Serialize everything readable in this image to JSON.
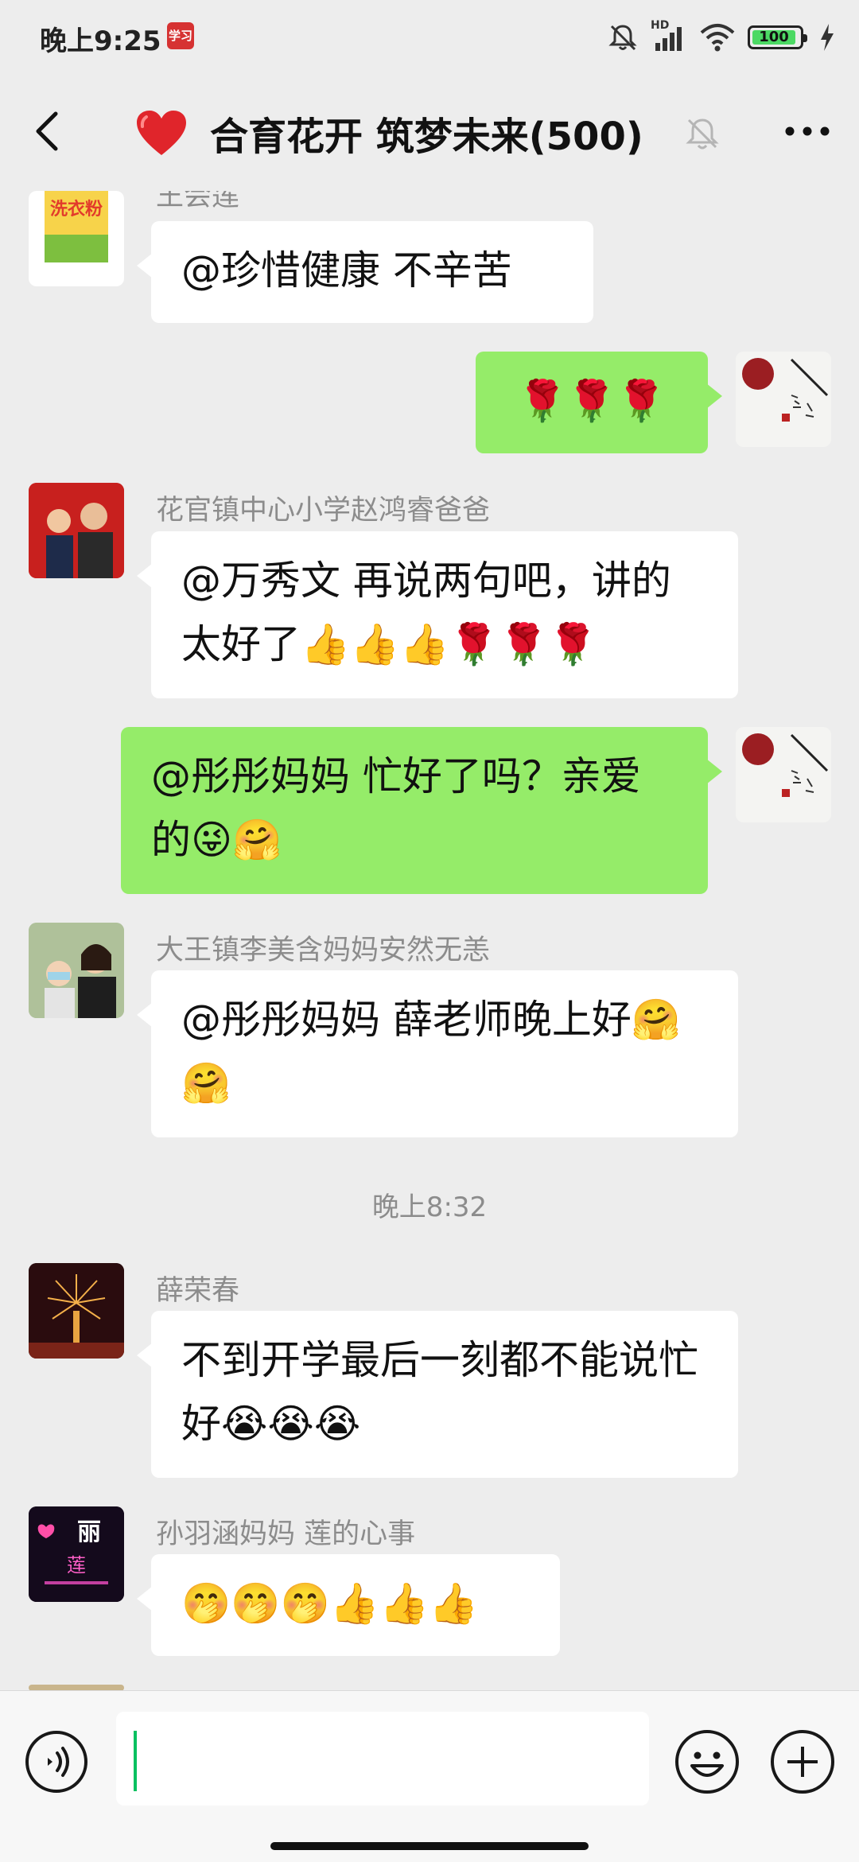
{
  "status_bar": {
    "time": "晚上9:25",
    "app_badge": "学习",
    "network_label": "HD",
    "battery_level": "100",
    "icons": [
      "mute-bell-icon",
      "signal-icon",
      "wifi-icon",
      "battery-icon",
      "charging-icon"
    ]
  },
  "header": {
    "back_icon": "back-arrow-icon",
    "heart_icon": "red-heart-icon",
    "title": "合育花开 筑梦未来(500)",
    "mute_icon": "bell-muted-icon",
    "more_icon": "more-dots-icon"
  },
  "messages": [
    {
      "sender": "王会莲",
      "text": "@珍惜健康  不辛苦",
      "is_me": false
    },
    {
      "sender": "",
      "text": "🌹🌹🌹",
      "is_me": true
    },
    {
      "sender": "花官镇中心小学赵鸿睿爸爸",
      "text": "@万秀文  再说两句吧，讲的太好了👍👍👍🌹🌹🌹",
      "is_me": false
    },
    {
      "sender": "",
      "text": "@彤彤妈妈  忙好了吗？亲爱的😜🤗",
      "is_me": true
    },
    {
      "sender": "大王镇李美含妈妈安然无恙",
      "text": "@彤彤妈妈  薛老师晚上好🤗🤗",
      "is_me": false
    },
    {
      "sender": "薛荣春",
      "text": "不到开学最后一刻都不能说忙好😭😭😭",
      "is_me": false
    },
    {
      "sender": "孙羽涵妈妈  莲的心事",
      "text": "🤭🤭🤭👍👍👍",
      "is_me": false
    }
  ],
  "time_separator": "晚上8:32",
  "avatars": {
    "wang_avatar_text": "洗衣粉",
    "li_avatar_text": "丽",
    "sun_avatar_text": "莲"
  },
  "input_bar": {
    "voice_icon": "voice-icon",
    "input_value": "",
    "emoji_icon": "emoji-icon",
    "plus_icon": "plus-icon"
  },
  "colors": {
    "background": "#EDEDED",
    "my_bubble": "#95EC69",
    "other_bubble": "#FFFFFF",
    "accent_green": "#07C160",
    "secondary_text": "#8C8C8C"
  }
}
